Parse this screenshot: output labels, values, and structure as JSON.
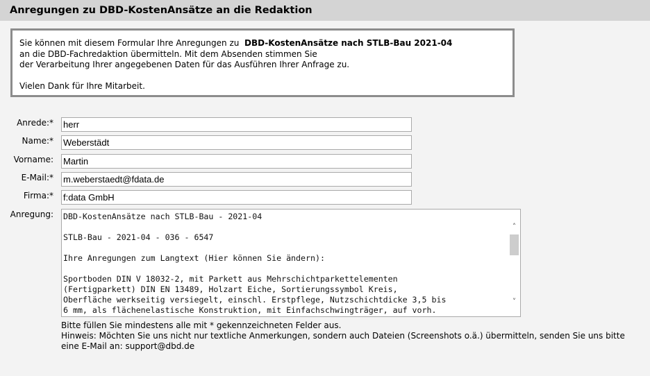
{
  "header": {
    "title": "Anregungen zu DBD-KostenAnsätze an die Redaktion"
  },
  "info": {
    "line1_prefix": "Sie können mit diesem Formular Ihre Anregungen zu",
    "line1_product": "DBD-KostenAnsätze nach STLB-Bau 2021-04",
    "line2": "an die DBD-Fachredaktion übermitteln. Mit dem Absenden stimmen Sie",
    "line3": "der Verarbeitung Ihrer angegebenen Daten für das Ausführen Ihrer Anfrage zu.",
    "thanks": "Vielen Dank für Ihre Mitarbeit."
  },
  "form": {
    "anrede": {
      "label": "Anrede:*",
      "value": "herr"
    },
    "name": {
      "label": "Name:*",
      "value": "Weberstädt"
    },
    "vorname": {
      "label": "Vorname:",
      "value": "Martin"
    },
    "email": {
      "label": "E-Mail:*",
      "value": "m.weberstaedt@fdata.de"
    },
    "firma": {
      "label": "Firma:*",
      "value": "f:data GmbH"
    },
    "anregung": {
      "label": "Anregung:",
      "value": "DBD-KostenAnsätze nach STLB-Bau - 2021-04\n\nSTLB-Bau - 2021-04 - 036 - 6547\n\nIhre Anregungen zum Langtext (Hier können Sie ändern):\n\nSportboden DIN V 18032-2, mit Parkett aus Mehrschichtparkettelementen\n(Fertigparkett) DIN EN 13489, Holzart Eiche, Sortierungssymbol Kreis,\nOberfläche werkseitig versiegelt, einschl. Erstpflege, Nutzschichtdicke 3,5 bis\n6 mm, als flächenelastische Konstruktion, mit Einfachschwingträger, auf vorh."
    }
  },
  "hints": {
    "required": "Bitte füllen Sie mindestens alle mit * gekennzeichneten Felder aus.",
    "files": "Hinweis: Möchten Sie uns nicht nur textliche Anmerkungen, sondern auch Dateien (Screenshots o.ä.) übermitteln, senden Sie uns bitte eine E-Mail an: support@dbd.de"
  },
  "icons": {
    "scroll_up": "chevron-up-icon",
    "scroll_down": "chevron-down-icon"
  }
}
